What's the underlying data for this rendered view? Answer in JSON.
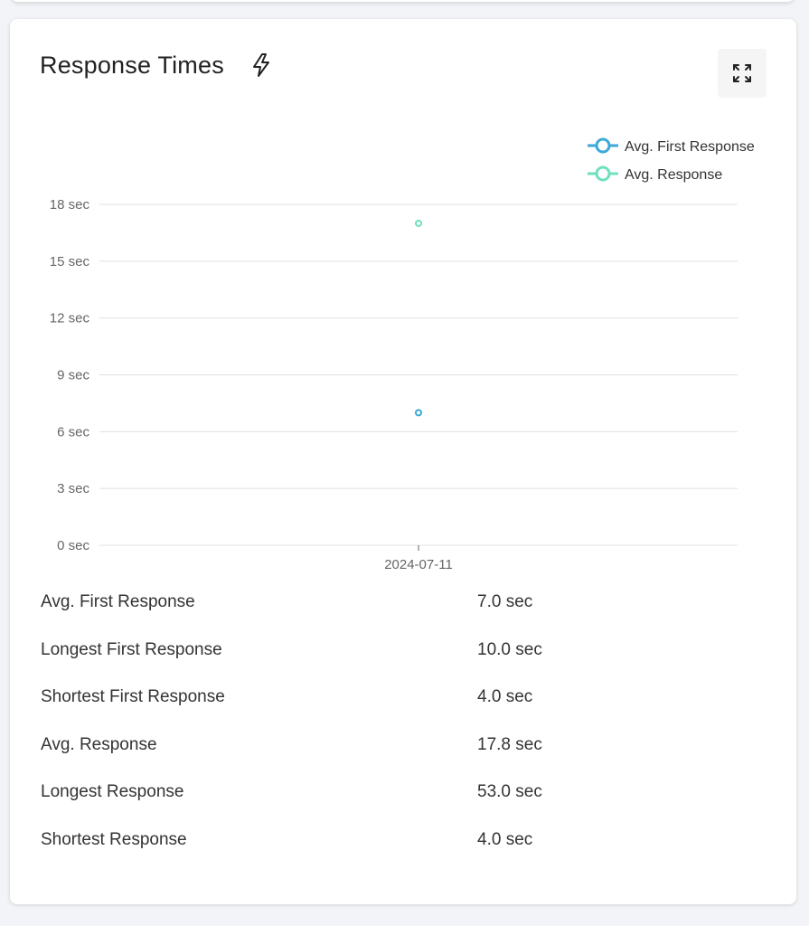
{
  "card": {
    "title": "Response Times",
    "title_icon": "lightning-bolt-icon",
    "expand_icon": "expand-icon"
  },
  "chart_data": {
    "type": "scatter",
    "categories": [
      "2024-07-11"
    ],
    "series": [
      {
        "name": "Avg. First Response",
        "values": [
          7.0
        ],
        "color": "#3ba9d8"
      },
      {
        "name": "Avg. Response",
        "values": [
          17.0
        ],
        "color": "#6ee0bd"
      }
    ],
    "y_ticks": [
      "0 sec",
      "3 sec",
      "6 sec",
      "9 sec",
      "12 sec",
      "15 sec",
      "18 sec"
    ],
    "ylim": [
      0,
      18
    ],
    "grid": true,
    "legend_position": "top-right"
  },
  "stats": [
    {
      "label": "Avg. First Response",
      "value": "7.0 sec"
    },
    {
      "label": "Longest First Response",
      "value": "10.0 sec"
    },
    {
      "label": "Shortest First Response",
      "value": "4.0 sec"
    },
    {
      "label": "Avg. Response",
      "value": "17.8 sec"
    },
    {
      "label": "Longest Response",
      "value": "53.0 sec"
    },
    {
      "label": "Shortest Response",
      "value": "4.0 sec"
    }
  ]
}
